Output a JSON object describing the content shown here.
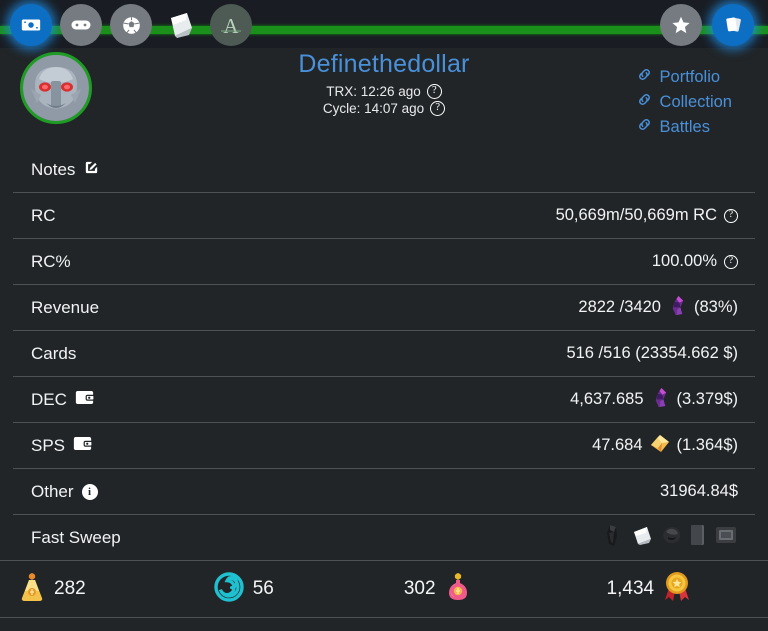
{
  "topnav": {
    "left_items": [
      {
        "name": "money-icon",
        "active": true
      },
      {
        "name": "gamepad-icon",
        "active": false
      },
      {
        "name": "soccer-ball-icon",
        "active": false
      },
      {
        "name": "card-pack-icon",
        "active": false
      },
      {
        "name": "alpha-logo-icon",
        "active": false
      }
    ],
    "right_items": [
      {
        "name": "star-icon",
        "active": false
      },
      {
        "name": "cards-icon",
        "active": true
      }
    ],
    "accent_green": "#1a8f1a",
    "accent_blue": "#0d6fc4"
  },
  "profile": {
    "username": "Definethedollar",
    "trx_label": "TRX: 12:26 ago",
    "cycle_label": "Cycle: 14:07 ago",
    "help_glyph": "?",
    "links": [
      {
        "label": "Portfolio"
      },
      {
        "label": "Collection"
      },
      {
        "label": "Battles"
      }
    ],
    "username_color": "#4a90d9"
  },
  "rows": {
    "notes_label": "Notes",
    "rc_label": "RC",
    "rc_value": "50,669m/50,669m RC",
    "rcpct_label": "RC%",
    "rcpct_value": "100.00%",
    "revenue_label": "Revenue",
    "revenue_value": "2822 /3420",
    "revenue_pct": "(83%)",
    "cards_label": "Cards",
    "cards_value": "516 /516 (23354.662 $)",
    "dec_label": "DEC",
    "dec_value": "4,637.685",
    "dec_usd": "(3.379$)",
    "sps_label": "SPS",
    "sps_value": "47.684",
    "sps_usd": "(1.364$)",
    "other_label": "Other",
    "other_value": "31964.84$",
    "info_glyph": "i",
    "fastsweep_label": "Fast Sweep"
  },
  "stats": [
    {
      "icon": "gold-potion-bag-icon",
      "value": "282",
      "order": "icon-first"
    },
    {
      "icon": "cyan-vortex-icon",
      "value": "56",
      "order": "icon-first"
    },
    {
      "icon": "pink-potion-icon",
      "value": "302",
      "order": "value-first"
    },
    {
      "icon": "gold-medal-icon",
      "value": "1,434",
      "order": "value-first"
    }
  ]
}
